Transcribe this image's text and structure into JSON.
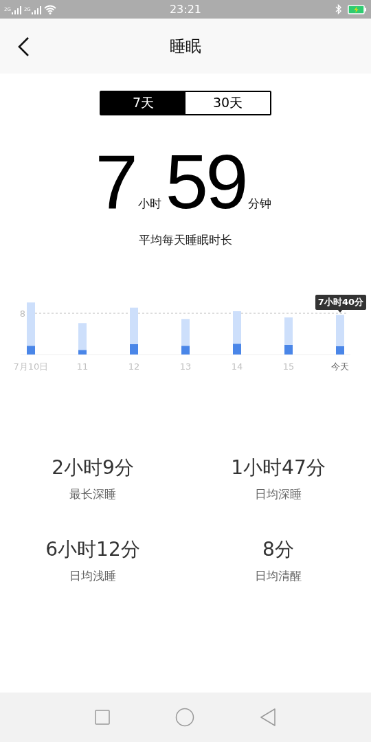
{
  "status_bar": {
    "signals": [
      "2G",
      "2G"
    ],
    "time": "23:21"
  },
  "header": {
    "title": "睡眠"
  },
  "tabs": [
    {
      "label": "7天",
      "selected": true
    },
    {
      "label": "30天",
      "selected": false
    }
  ],
  "summary": {
    "hours": "7",
    "hours_unit": "小时",
    "minutes": "59",
    "minutes_unit": "分钟",
    "caption": "平均每天睡眠时长"
  },
  "chart": {
    "tooltip": "7小时40分",
    "reference_label": "8",
    "day_labels": [
      "7月10日",
      "11",
      "12",
      "13",
      "14",
      "15",
      "今天"
    ]
  },
  "stats": [
    {
      "value": "2小时9分",
      "label": "最长深睡"
    },
    {
      "value": "1小时47分",
      "label": "日均深睡"
    },
    {
      "value": "6小时12分",
      "label": "日均浅睡"
    },
    {
      "value": "8分",
      "label": "日均清醒"
    }
  ]
}
